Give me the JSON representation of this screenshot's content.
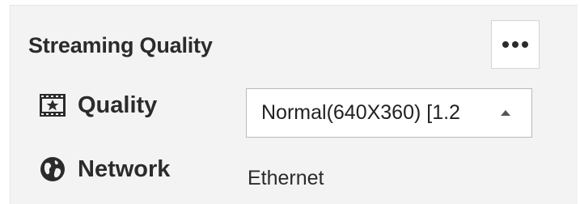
{
  "panel": {
    "title": "Streaming Quality",
    "more_icon": "more-dots-icon"
  },
  "quality": {
    "label": "Quality",
    "icon": "film-star-icon",
    "selected_value": "Normal(640X360) [1.2"
  },
  "network": {
    "label": "Network",
    "icon": "globe-icon",
    "value": "Ethernet"
  }
}
